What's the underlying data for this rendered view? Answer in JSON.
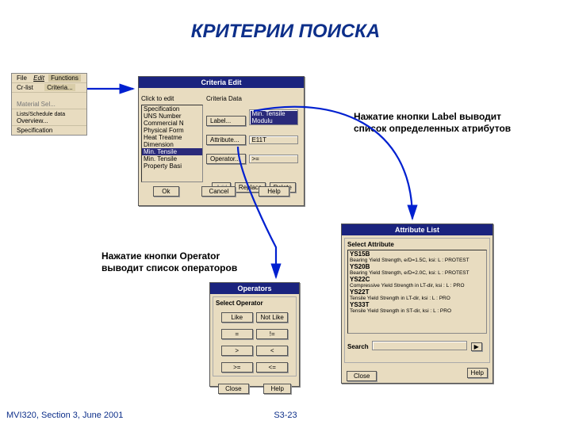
{
  "title": "КРИТЕРИИ ПОИСКА",
  "footer_left": "MVI320, Section 3, June 2001",
  "footer_center": "S3-23",
  "annotation_label": "Нажатие кнопки Label выводит список определенных атрибутов",
  "annotation_operator": "Нажатие кнопки Operator выводит список операторов",
  "menu": {
    "top": {
      "file": "File",
      "edit": "Edit",
      "function": "Functions"
    },
    "row2": {
      "a": "Cr-list",
      "b": "Criteria..."
    },
    "row3": {
      "a": "",
      "b": "Material Sel..."
    },
    "row4": {
      "a": "Lists/Schedule data",
      "b": "Overview..."
    },
    "row5": {
      "a": "Specification",
      "b": ""
    }
  },
  "criteria": {
    "title": "Criteria Edit",
    "col1": "Click to edit",
    "col2": "Criteria Data",
    "list": {
      "i0": "Specification",
      "i1": "UNS Number",
      "i2": "Commercial N",
      "i3": "Physical Form",
      "i4": "Heat Treatme",
      "i5": "Dimension",
      "i6": "Min. Tensile",
      "i7": "Min. Tensile",
      "i8": "Property Basi"
    },
    "label_btn": "Label...",
    "label_val": "Min. Tensile Modulu",
    "attr_btn": "Attribute...",
    "attr_val": "E11T",
    "op_btn": "Operator...",
    "op_val": ">=",
    "add": "Add",
    "replace": "Replace",
    "delete": "Delete",
    "ok": "Ok",
    "cancel": "Cancel",
    "help": "Help"
  },
  "operators": {
    "title": "Operators",
    "header": "Select Operator",
    "b0": "Like",
    "b1": "Not Like",
    "b2": "=",
    "b3": "!=",
    "b4": ">",
    "b5": "<",
    "b6": ">=",
    "b7": "<=",
    "close": "Close",
    "help": "Help"
  },
  "attrlist": {
    "title": "Attribute List",
    "header": "Select Attribute",
    "i0n": "YS15B",
    "i0d": "Bearing Yield Strength, e/D=1.5C, ksi: L : PROTEST",
    "i1n": "YS20B",
    "i1d": "Bearing Yield Strength, e/D=2.0C, ksi: L : PROTEST",
    "i2n": "YS22C",
    "i2d": "Compressive Yield Strength in LT-dir, ksi : L : PRO",
    "i3n": "YS22T",
    "i3d": "Tensile Yield Strength in LT-dir, ksi : L : PRO",
    "i4n": "YS33T",
    "i4d": "Tensile Yield Strength in ST-dir, ksi : L : PRO",
    "search_label": "Search",
    "close": "Close",
    "help": "Help"
  }
}
